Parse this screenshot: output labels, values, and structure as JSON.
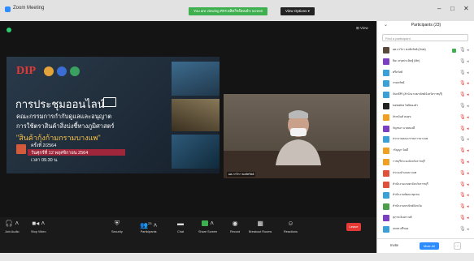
{
  "app": {
    "title": "Zoom Meeting"
  },
  "share_banner": {
    "text": "You are viewing ศจร.ผลิตกิจนิพนธ์'s screen"
  },
  "view_options": {
    "label": "View Options ▾"
  },
  "view_label": "⊞ View",
  "window_controls": {
    "minimize": "–",
    "maximize": "□",
    "close": "✕"
  },
  "slide": {
    "logo_text": "DIP",
    "heading": "การประชุมออนไลน์",
    "line1": "คณะกรรมการกำกับดูแลและอนุญาต",
    "line2": "การใช้ตราสินค้าสิ่งบ่งชี้ทางภูมิศาสตร์",
    "highlight": "\"สินค้ากุ้งก้ามกรามบางแพ\"",
    "meeting_no": "ครั้งที่ 2/2564",
    "date": "วันศุกร์ที่ 12 พฤศจิกายน 2564",
    "time": "เวลา 09.30 น."
  },
  "camera": {
    "name": "ผศ.ภาวิกา พงษ์ทรัพย์"
  },
  "self_view": {
    "name": "ปิยะ ตรุษประดิษฐ์"
  },
  "toolbar": {
    "join_audio": "Join Audio",
    "stop_video": "Stop Video",
    "security": "Security",
    "participants": "Participants",
    "participants_count": "23",
    "chat": "Chat",
    "share_screen": "Share Screen",
    "record": "Record",
    "breakout": "Breakout Rooms",
    "reactions": "Reactions",
    "leave": "Leave"
  },
  "colors": {
    "accent": "#2d8cff",
    "share_green": "#3fb04f",
    "leave_red": "#e53935",
    "muted_red": "#e53935"
  },
  "panel": {
    "title": "Participants (23)",
    "search_placeholder": "Find a participant",
    "participants": [
      {
        "name": "ผศ.ภาวิกา พงษ์ทรัพย์ (Host)",
        "color": "#5a4a3c",
        "host": true,
        "muted": false
      },
      {
        "name": "ปิยะ ตรุษประดิษฐ์ (Me)",
        "color": "#7b3fc4",
        "host": false,
        "muted": false
      },
      {
        "name": "ศรีสวัสดิ์",
        "color": "#3aa0d8",
        "host": false,
        "muted": false
      },
      {
        "name": "กรมทรัพย์",
        "color": "#3aa0d8",
        "host": false,
        "muted": true
      },
      {
        "name": "จันทร์สิริ (สำนักงานพาณิชย์จังหวัดราชบุรี)",
        "color": "#3aa0d8",
        "host": false,
        "muted": true
      },
      {
        "name": "kunnatha โพธิ์ทองคำ",
        "color": "#222222",
        "host": false,
        "muted": false
      },
      {
        "name": "ภัทรนันท์ คงสุข",
        "color": "#f0a020",
        "host": false,
        "muted": true
      },
      {
        "name": "กัญชนก นาคทองดี",
        "color": "#7b3fc4",
        "host": false,
        "muted": true
      },
      {
        "name": "ประธานคณะกรรมการบางแพ",
        "color": "#3aa0d8",
        "host": false,
        "muted": false
      },
      {
        "name": "วรัญญา นิลดี",
        "color": "#f0a020",
        "host": false,
        "muted": true
      },
      {
        "name": "ราชบุรีประมงจังหวัดราชบุรี",
        "color": "#f0a020",
        "host": false,
        "muted": true
      },
      {
        "name": "ประมงอำเภอบางแพ",
        "color": "#e0503a",
        "host": false,
        "muted": true
      },
      {
        "name": "สำนักงานเกษตรจังหวัดราชบุรี",
        "color": "#e0503a",
        "host": false,
        "muted": true
      },
      {
        "name": "สำนักงานพัฒนาชุมชน",
        "color": "#3aa0d8",
        "host": false,
        "muted": true
      },
      {
        "name": "สำนักงานพาณิชย์จังหวัด",
        "color": "#4aa04a",
        "host": false,
        "muted": true
      },
      {
        "name": "สุภาพ อินทรวงศ์",
        "color": "#7b3fc4",
        "host": false,
        "muted": true
      },
      {
        "name": "ธนพร ศรีทอง",
        "color": "#3aa0d8",
        "host": false,
        "muted": false
      }
    ],
    "invite": "Invite",
    "mute_all": "Mute All",
    "more": "···"
  }
}
